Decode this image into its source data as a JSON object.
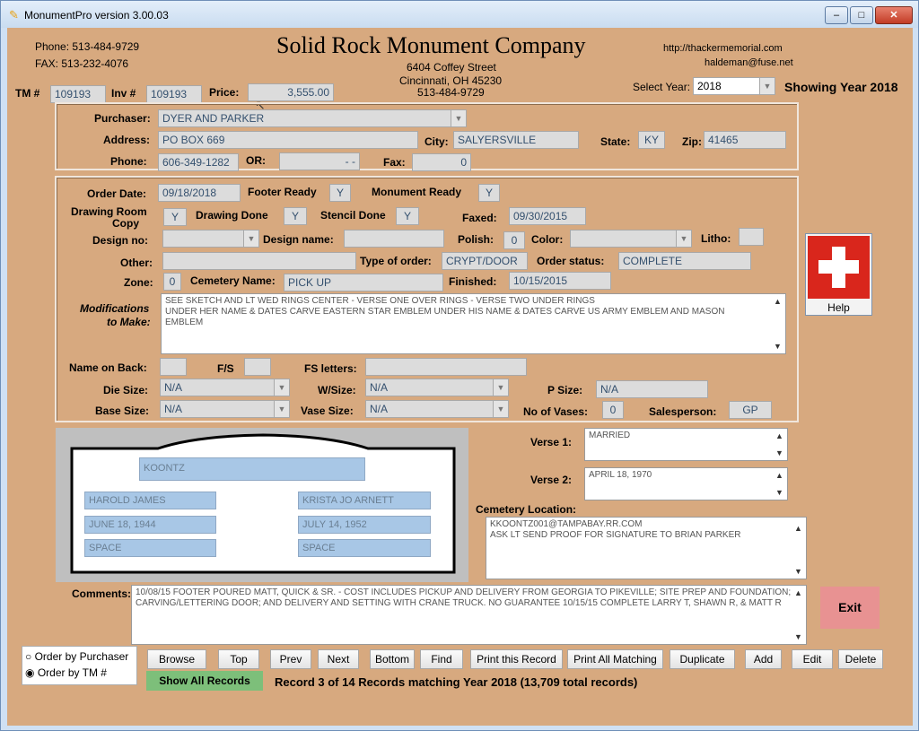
{
  "window": {
    "title": "MonumentPro version 3.00.03",
    "min": "–",
    "max": "□",
    "close": "✕"
  },
  "company": {
    "phone": "Phone: 513-484-9729",
    "fax": "FAX: 513-232-4076",
    "name": "Solid Rock Monument Company",
    "street": "6404 Coffey Street",
    "city_state": "Cincinnati, OH 45230",
    "phone2": "513-484-9729",
    "website": "http://thackermemorial.com",
    "email": "haldeman@fuse.net"
  },
  "header": {
    "tm_label": "TM #",
    "tm_value": "109193",
    "inv_label": "Inv #",
    "inv_value": "109193",
    "price_label": "Price:",
    "price_value": "3,555.00",
    "select_year_label": "Select Year:",
    "select_year_value": "2018",
    "showing_year": "Showing Year 2018"
  },
  "purchaser": {
    "purchaser_label": "Purchaser:",
    "purchaser_value": "DYER AND PARKER",
    "address_label": "Address:",
    "address_value": "PO BOX 669",
    "city_label": "City:",
    "city_value": "SALYERSVILLE",
    "state_label": "State:",
    "state_value": "KY",
    "zip_label": "Zip:",
    "zip_value": "41465",
    "phone_label": "Phone:",
    "phone_value": "606-349-1282",
    "or_label": "OR:",
    "or_value": "-  -",
    "fax_label": "Fax:",
    "fax_value": "0"
  },
  "order": {
    "order_date_label": "Order Date:",
    "order_date_value": "09/18/2018",
    "footer_ready_label": "Footer Ready",
    "footer_ready_value": "Y",
    "monument_ready_label": "Monument Ready",
    "monument_ready_value": "Y",
    "drawing_room_label_1": "Drawing Room",
    "drawing_room_label_2": "Copy",
    "drawing_room_value": "Y",
    "drawing_done_label": "Drawing Done",
    "drawing_done_value": "Y",
    "stencil_done_label": "Stencil Done",
    "stencil_done_value": "Y",
    "faxed_label": "Faxed:",
    "faxed_value": "09/30/2015",
    "design_no_label": "Design no:",
    "design_no_value": "",
    "design_name_label": "Design name:",
    "design_name_value": "",
    "polish_label": "Polish:",
    "polish_value": "0",
    "color_label": "Color:",
    "color_value": "",
    "litho_label": "Litho:",
    "litho_value": "",
    "other_label": "Other:",
    "other_value": "",
    "type_of_order_label": "Type of order:",
    "type_of_order_value": "CRYPT/DOOR",
    "order_status_label": "Order status:",
    "order_status_value": "COMPLETE",
    "zone_label": "Zone:",
    "zone_value": "0",
    "cemetery_name_label": "Cemetery Name:",
    "cemetery_name_value": "PICK UP",
    "finished_label": "Finished:",
    "finished_value": "10/15/2015",
    "modifications_label_1": "Modifications",
    "modifications_label_2": "to Make:",
    "modifications_line1": "SEE SKETCH AND LT  WED RINGS CENTER - VERSE ONE OVER RINGS - VERSE TWO UNDER RINGS",
    "modifications_line2": "UNDER HER NAME & DATES CARVE EASTERN STAR EMBLEM  UNDER HIS NAME & DATES CARVE US ARMY EMBLEM AND MASON",
    "modifications_line3": "EMBLEM",
    "name_on_back_label": "Name on Back:",
    "name_on_back_value": "",
    "fs_label": "F/S",
    "fs_value": "",
    "fs_letters_label": "FS letters:",
    "fs_letters_value": "",
    "die_size_label": "Die Size:",
    "die_size_value": "N/A",
    "wsize_label": "W/Size:",
    "wsize_value": "N/A",
    "psize_label": "P Size:",
    "psize_value": "N/A",
    "base_size_label": "Base Size:",
    "base_size_value": "N/A",
    "vase_size_label": "Vase Size:",
    "vase_size_value": "N/A",
    "no_of_vases_label": "No of Vases:",
    "no_of_vases_value": "0",
    "salesperson_label": "Salesperson:",
    "salesperson_value": "GP"
  },
  "help": {
    "label": "Help"
  },
  "stone": {
    "family_name": "KOONTZ",
    "left_name": "HAROLD JAMES",
    "left_date": "JUNE 18, 1944",
    "left_extra": "SPACE",
    "right_name": "KRISTA JO ARNETT",
    "right_date": "JULY 14, 1952",
    "right_extra": "SPACE"
  },
  "verses": {
    "verse1_label": "Verse 1:",
    "verse1_value": "MARRIED",
    "verse2_label": "Verse 2:",
    "verse2_value": "APRIL 18, 1970",
    "cemetery_location_label": "Cemetery Location:",
    "cemetery_location_line1": "KKOONTZ001@TAMPABAY.RR.COM",
    "cemetery_location_line2": "ASK LT SEND PROOF FOR SIGNATURE TO BRIAN PARKER"
  },
  "comments": {
    "label": "Comments:",
    "line1": "10/08/15 FOOTER POURED MATT, QUICK & SR. - COST INCLUDES PICKUP AND DELIVERY FROM GEORGIA TO PIKEVILLE; SITE PREP AND FOUNDATION;",
    "line2": "CARVING/LETTERING DOOR; AND DELIVERY AND SETTING WITH CRANE TRUCK. NO GUARANTEE 10/15/15 COMPLETE LARRY T, SHAWN R, & MATT R"
  },
  "exit_label": "Exit",
  "order_by": {
    "purchaser": "Order by Purchaser",
    "tm": "Order by TM #"
  },
  "buttons": {
    "browse": "Browse",
    "top": "Top",
    "prev": "Prev",
    "next": "Next",
    "bottom": "Bottom",
    "find": "Find",
    "print_record": "Print this Record",
    "print_all": "Print All Matching",
    "duplicate": "Duplicate",
    "add": "Add",
    "edit": "Edit",
    "delete": "Delete",
    "show_all": "Show All Records"
  },
  "status": "Record 3 of 14 Records matching Year 2018 (13,709 total records)",
  "colors": {
    "client_bg": "#d7a97f",
    "help_red": "#d9261c",
    "exit_bg": "#e89292",
    "show_all_bg": "#7dbf7a",
    "stone_blue": "#a8c7e6"
  }
}
